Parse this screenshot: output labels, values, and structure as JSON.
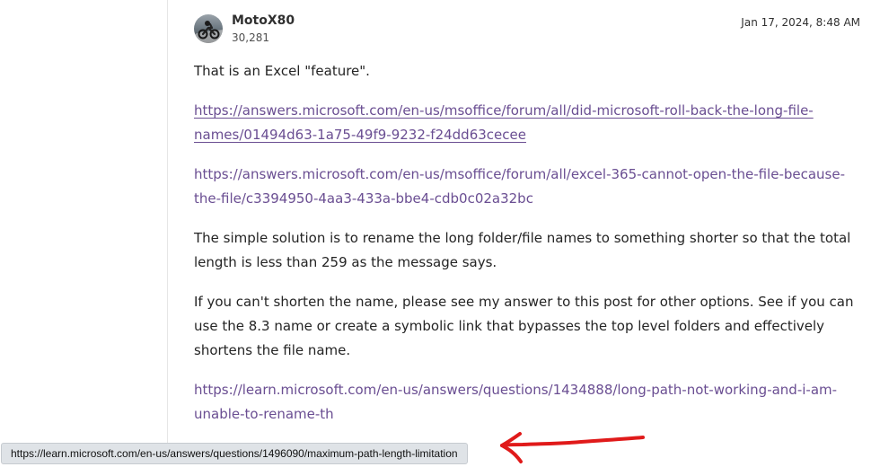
{
  "post": {
    "author": "MotoX80",
    "reputation": "30,281",
    "timestamp": "Jan 17, 2024, 8:48 AM",
    "paragraphs": [
      "That is an Excel \"feature\".",
      "The simple solution is to rename the long folder/file names to something shorter so that the total length is less than 259 as the message says.",
      "If you can't shorten the name, please see my answer to this post for other options. See if you can use the 8.3 name or create a symbolic link that bypasses the top level folders and effectively shortens the file name."
    ],
    "links": [
      {
        "text": "https://answers.microsoft.com/en-us/msoffice/forum/all/did-microsoft-roll-back-the-long-file-names/01494d63-1a75-49f9-9232-f24dd63cecee"
      },
      {
        "text": "https://answers.microsoft.com/en-us/msoffice/forum/all/excel-365-cannot-open-the-file-because-the-file/c3394950-4aa3-433a-bbe4-cdb0c02a32bc"
      },
      {
        "text": "https://learn.microsoft.com/en-us/answers/questions/1434888/long-path-not-working-and-i-am-unable-to-rename-th"
      }
    ]
  },
  "status_bar": {
    "url": "https://learn.microsoft.com/en-us/answers/questions/1496090/maximum-path-length-limitation"
  },
  "colors": {
    "link": "#6a4e92",
    "annotation": "#e01a1a",
    "status_bar_bg": "#dfe3e7"
  },
  "icons": {
    "avatar": "motorcycle-avatar-icon",
    "annotation": "red-arrow-icon"
  }
}
